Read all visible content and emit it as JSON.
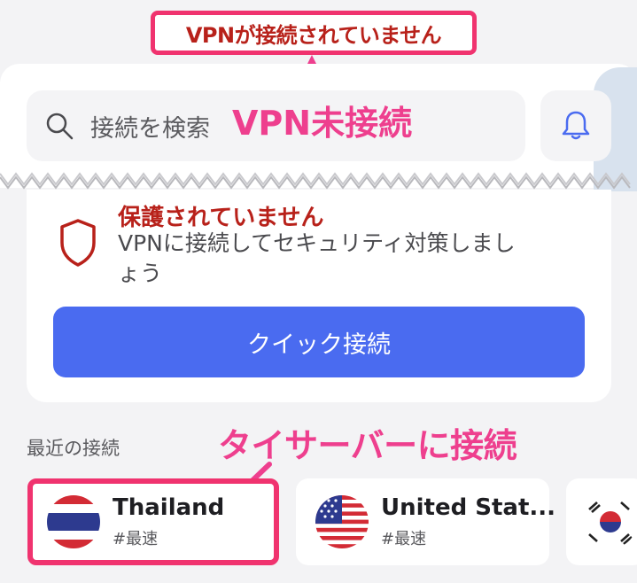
{
  "annotations": {
    "top_banner": "VPNが接続されていません",
    "vpn_status": "VPN未接続",
    "connect_thai": "タイサーバーに接続"
  },
  "search": {
    "placeholder": "接続を検索"
  },
  "status": {
    "title": "保護されていません",
    "description": "VPNに接続してセキュリティ対策しましょう"
  },
  "quick_connect": {
    "label": "クイック接続"
  },
  "recent": {
    "label": "最近の接続",
    "servers": [
      {
        "name": "Thailand",
        "tag": "#最速",
        "flag": "thailand-flag"
      },
      {
        "name": "United Stat...",
        "tag": "#最速",
        "flag": "us-flag"
      },
      {
        "name": "",
        "tag": "",
        "flag": "south-korea-flag"
      }
    ]
  },
  "colors": {
    "accent_pink": "#ee3f8e",
    "callout_border": "#f0336f",
    "warning_red": "#b8211a",
    "button_blue": "#4a6bf0"
  },
  "icons": [
    "search-icon",
    "bell-icon",
    "shield-icon",
    "arrow-icon"
  ]
}
